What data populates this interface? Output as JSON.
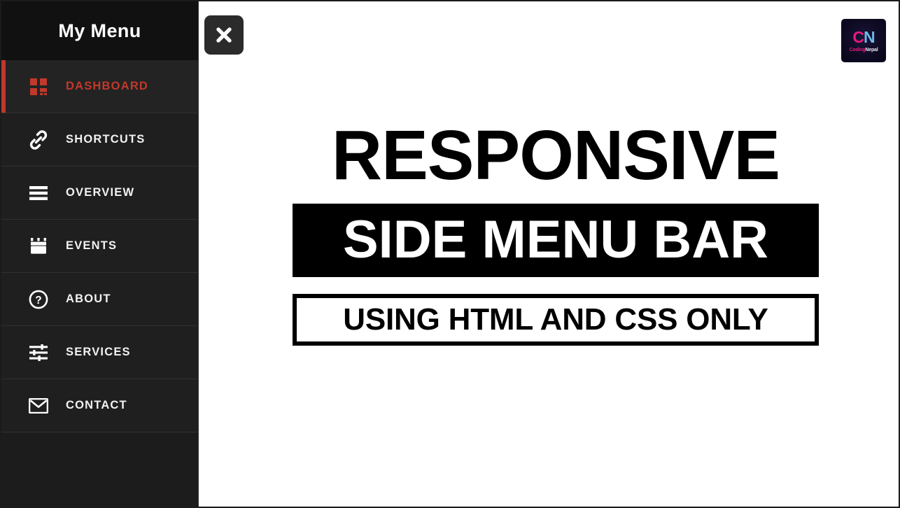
{
  "sidebar": {
    "title": "My Menu",
    "items": [
      {
        "label": "DASHBOARD",
        "icon": "grid-icon",
        "active": true
      },
      {
        "label": "SHORTCUTS",
        "icon": "link-icon",
        "active": false
      },
      {
        "label": "OVERVIEW",
        "icon": "bars-icon",
        "active": false
      },
      {
        "label": "EVENTS",
        "icon": "calendar-icon",
        "active": false
      },
      {
        "label": "ABOUT",
        "icon": "question-circle-icon",
        "active": false
      },
      {
        "label": "SERVICES",
        "icon": "sliders-icon",
        "active": false
      },
      {
        "label": "CONTACT",
        "icon": "envelope-icon",
        "active": false
      }
    ],
    "active_color": "#c0392b",
    "background_color": "#1f1f1f",
    "header_background_color": "#111111"
  },
  "close_button": {
    "icon": "close-icon",
    "label": ""
  },
  "logo": {
    "mark_c": "C",
    "mark_n": "N",
    "text_primary": "Coding",
    "text_secondary": "Nepal",
    "primary_color": "#e8197d",
    "secondary_color": "#6fb7e8"
  },
  "main": {
    "heading_line1": "RESPONSIVE",
    "heading_line2": "SIDE MENU BAR",
    "heading_line3": "USING HTML AND CSS ONLY"
  }
}
